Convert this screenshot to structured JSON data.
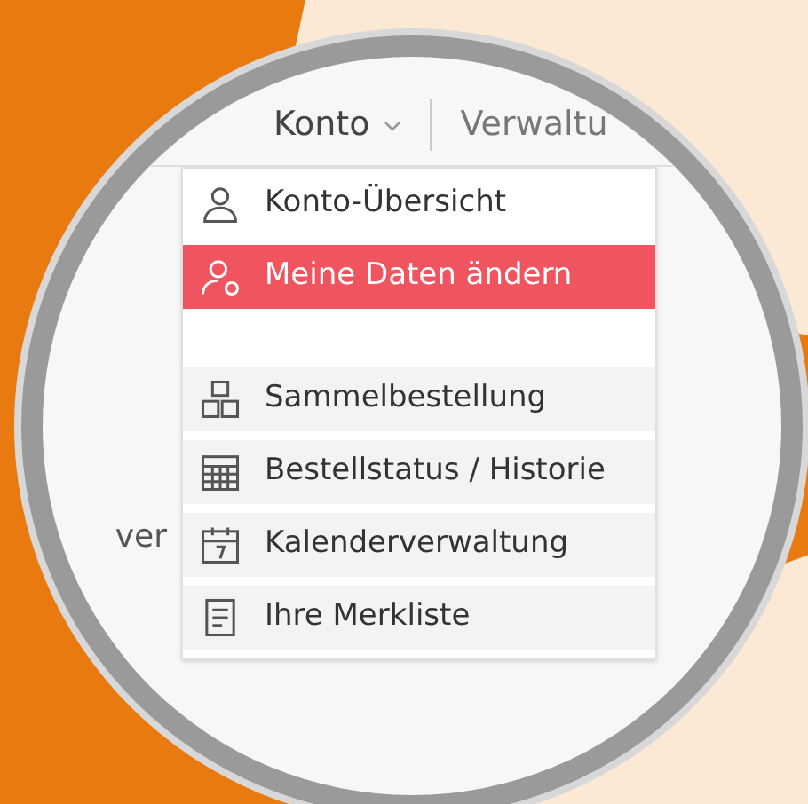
{
  "top_menu": [
    {
      "label": "Konto",
      "selected": true
    },
    {
      "label": "Verwaltu",
      "selected": false
    }
  ],
  "side_text": "ver",
  "dropdown": [
    {
      "label": "Konto-Übersicht",
      "kind": "user",
      "selected": false
    },
    {
      "label": "Meine Daten ändern",
      "kind": "user-gear",
      "selected": true
    },
    {
      "label": "Sammelbestellung",
      "kind": "boxes",
      "selected": false
    },
    {
      "label": "Bestellstatus / Historie",
      "kind": "grid",
      "selected": false
    },
    {
      "label": "Kalenderverwaltung",
      "kind": "calendar",
      "selected": false
    },
    {
      "label": "Ihre Merkliste",
      "kind": "note",
      "selected": false
    }
  ]
}
